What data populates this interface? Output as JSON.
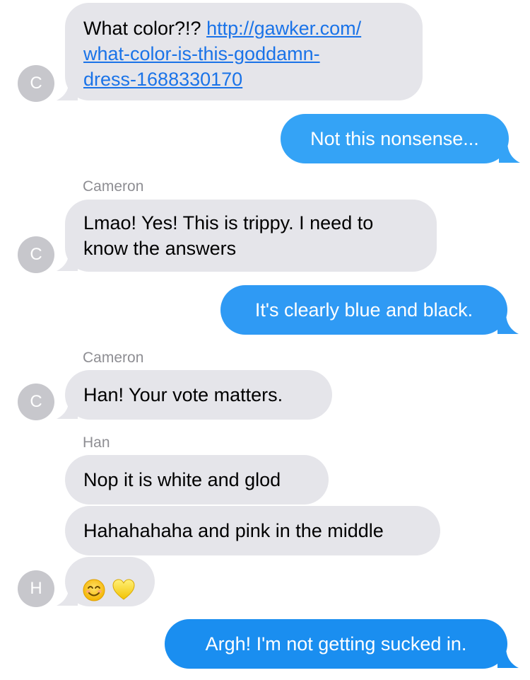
{
  "colors": {
    "incoming_bubble": "#e5e5ea",
    "outgoing_bubble_light": "#34a3f6",
    "outgoing_bubble_dark": "#1a8ef0",
    "link": "#1a73e8",
    "avatar": "#c7c7cc",
    "sender_name": "#8e8e93"
  },
  "messages": {
    "m1": {
      "text": "What color?!? ",
      "link_line1": "http://gawker.com/",
      "link_line2": "what-color-is-this-goddamn-",
      "link_line3": "dress-1688330170",
      "avatar": "C"
    },
    "m2": {
      "text": "Not this nonsense..."
    },
    "m3": {
      "sender": "Cameron",
      "line1": "Lmao! Yes! This is trippy. I need to",
      "line2": "know the answers",
      "avatar": "C"
    },
    "m4": {
      "text": "It's clearly blue and black."
    },
    "m5": {
      "sender": "Cameron",
      "text": "Han! Your vote matters.",
      "avatar": "C"
    },
    "m6": {
      "sender": "Han",
      "text": "Nop it is white and glod"
    },
    "m7": {
      "text": "Hahahahaha and pink in the middle"
    },
    "m8": {
      "emoji": [
        "smiling-face-emoji",
        "yellow-heart-emoji"
      ],
      "avatar": "H"
    },
    "m9": {
      "text": "Argh! I'm not getting sucked in."
    }
  }
}
